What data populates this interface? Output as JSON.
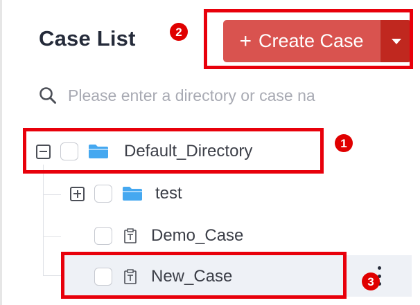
{
  "panel": {
    "title": "Case List"
  },
  "toolbar": {
    "create_label": "Create Case",
    "create_icon": "plus-icon",
    "dropdown_icon": "caret-down-icon",
    "accent": "#d9534f",
    "accent_dark": "#c0281f"
  },
  "search": {
    "placeholder": "Please enter a directory or case na",
    "value": "",
    "icon": "search-icon"
  },
  "tree": {
    "root": {
      "label": "Default_Directory",
      "expanded": true,
      "icon": "folder-icon"
    },
    "children": [
      {
        "label": "test",
        "type": "folder",
        "expanded": false,
        "icon": "folder-icon"
      },
      {
        "label": "Demo_Case",
        "type": "case",
        "icon": "case-icon"
      },
      {
        "label": "New_Case",
        "type": "case",
        "icon": "case-icon",
        "hovered": true
      }
    ]
  },
  "annotations": {
    "badges": [
      "1",
      "2",
      "3"
    ],
    "highlight_color": "#e8000b"
  }
}
